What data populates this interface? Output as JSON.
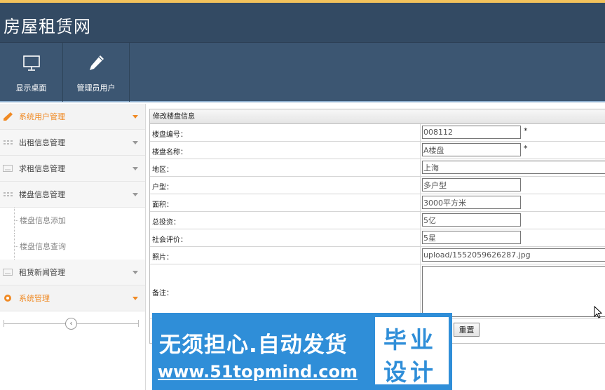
{
  "app": {
    "title": "房屋租赁网"
  },
  "toolbar": {
    "buttons": [
      {
        "label": "显示桌面",
        "icon": "monitor-icon"
      },
      {
        "label": "管理员用户",
        "icon": "pencil-icon"
      }
    ]
  },
  "sidebar": {
    "items": [
      {
        "label": "系统用户管理",
        "icon": "pencil-icon",
        "active": true
      },
      {
        "label": "出租信息管理",
        "icon": "grid-icon"
      },
      {
        "label": "求租信息管理",
        "icon": "keyboard-icon"
      },
      {
        "label": "楼盘信息管理",
        "icon": "grid-icon"
      },
      {
        "label": "租赁新闻管理",
        "icon": "keyboard-icon"
      },
      {
        "label": "系统管理",
        "icon": "gear-icon",
        "active": true
      }
    ],
    "sub_items": [
      "楼盘信息添加",
      "楼盘信息查询"
    ],
    "collapse_glyph": "‹"
  },
  "form": {
    "title": "修改楼盘信息",
    "fields": [
      {
        "label": "楼盘编号：",
        "value": "008112",
        "required_mark": "*"
      },
      {
        "label": "楼盘名称：",
        "value": "A楼盘",
        "required_mark": "*"
      },
      {
        "label": "地区：",
        "value": "上海"
      },
      {
        "label": "户型：",
        "value": "多户型"
      },
      {
        "label": "面积：",
        "value": "3000平方米"
      },
      {
        "label": "总投资：",
        "value": "5亿"
      },
      {
        "label": "社会评价：",
        "value": "5星"
      },
      {
        "label": "照片：",
        "value": "upload/1552059626287.jpg"
      }
    ],
    "remark_label": "备注：",
    "remark_value": "",
    "reset_label": "重置"
  },
  "banner": {
    "slogan": "无须担心.自动发货",
    "site": "www.51topmind.com",
    "stamp_line1": "毕业",
    "stamp_line2": "设计"
  },
  "colors": {
    "header_bg": "#334a63",
    "toolbar_bg": "#3c5672",
    "accent": "#f08a24",
    "top_border": "#f2c25c",
    "banner": "#2f8ed8"
  }
}
